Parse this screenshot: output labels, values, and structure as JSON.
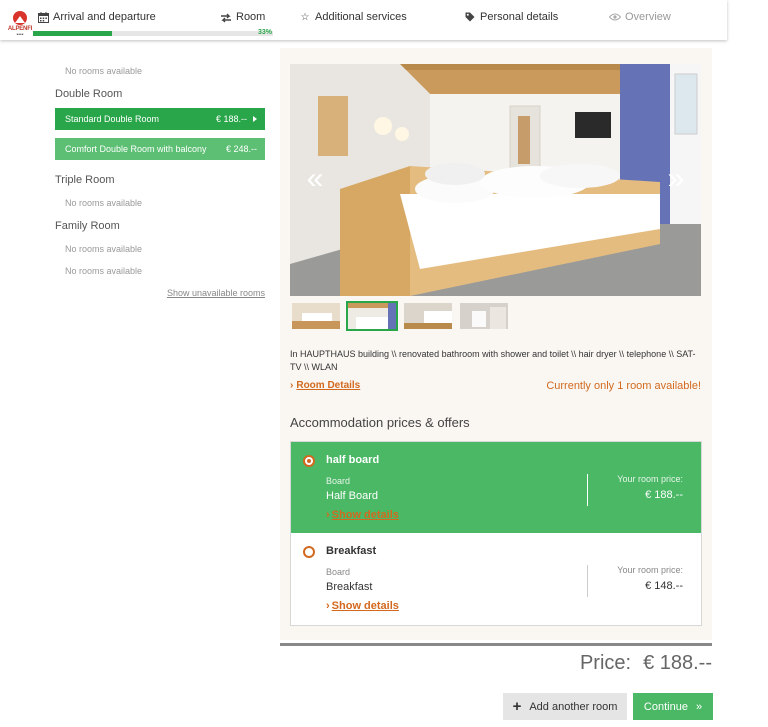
{
  "header": {
    "logo_text": "ALPENFI",
    "logo_stars": "••••",
    "steps": [
      {
        "label": "Arrival and departure",
        "icon": "calendar-icon"
      },
      {
        "label": "Room",
        "icon": "room-arrows-icon"
      },
      {
        "label": "Additional services",
        "icon": "star-icon"
      },
      {
        "label": "Personal details",
        "icon": "tag-icon"
      },
      {
        "label": "Overview",
        "icon": "eye-icon"
      }
    ],
    "progress_label": "33%",
    "progress_value": 0.33
  },
  "rooms": {
    "top_no_rooms": "No rooms available",
    "double_label": "Double Room",
    "standard_double": {
      "name": "Standard Double Room",
      "price": "€ 188.--"
    },
    "comfort_double": {
      "name": "Comfort Double Room with balcony",
      "price": "€ 248.--"
    },
    "triple_label": "Triple Room",
    "triple_no_rooms": "No rooms available",
    "family_label": "Family Room",
    "family_no_rooms_1": "No rooms available",
    "family_no_rooms_2": "No rooms available",
    "show_unavailable": "Show unavailable rooms"
  },
  "details": {
    "prev_arrow": "«",
    "next_arrow": "»",
    "description": "In HAUPTHAUS building \\\\ renovated bathroom with shower and toilet \\\\ hair dryer \\\\ telephone \\\\ SAT-TV \\\\ WLAN",
    "room_details_link": "Room Details",
    "availability": "Currently only 1 room available!",
    "accommodation_title": "Accommodation prices & offers"
  },
  "offers": [
    {
      "name": "half board",
      "board_label": "Board",
      "board_value": "Half Board",
      "show_details": "Show details",
      "price_label": "Your room price:",
      "price": "€ 188.--"
    },
    {
      "name": "Breakfast",
      "board_label": "Board",
      "board_value": "Breakfast",
      "show_details": "Show details",
      "price_label": "Your room price:",
      "price": "€ 148.--"
    }
  ],
  "footer": {
    "price_label": "Price:",
    "price_value": "€ 188.--",
    "add_room": "Add another room",
    "continue": "Continue"
  },
  "colors": {
    "accent_green": "#2aa64a",
    "offer_green": "#4ab865",
    "link_orange": "#d2691e"
  }
}
